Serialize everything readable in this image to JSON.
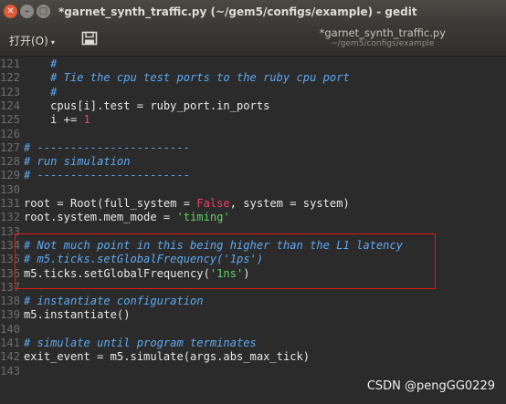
{
  "window": {
    "title": "*garnet_synth_traffic.py (~/gem5/configs/example) - gedit",
    "close_glyph": "✕",
    "minimize_glyph": "–",
    "maximize_glyph": "□"
  },
  "toolbar": {
    "open_label": "打开(O)",
    "open_arrow": "▾",
    "save_icon": "save-icon",
    "doc_title": "*garnet_synth_traffic.py",
    "doc_path": "~/gem5/configs/example"
  },
  "editor": {
    "lines": [
      {
        "n": "121",
        "segs": [
          {
            "t": "    #",
            "c": "comment"
          }
        ]
      },
      {
        "n": "122",
        "segs": [
          {
            "t": "    # Tie the cpu test ports to the ruby cpu port",
            "c": "comment"
          }
        ]
      },
      {
        "n": "123",
        "segs": [
          {
            "t": "    #",
            "c": "comment"
          }
        ]
      },
      {
        "n": "124",
        "segs": [
          {
            "t": "    cpus[i].test = ruby_port.in_ports",
            "c": "plain"
          }
        ]
      },
      {
        "n": "125",
        "segs": [
          {
            "t": "    i += ",
            "c": "plain"
          },
          {
            "t": "1",
            "c": "num"
          }
        ]
      },
      {
        "n": "126",
        "segs": []
      },
      {
        "n": "127",
        "segs": [
          {
            "t": "# -----------------------",
            "c": "comment"
          }
        ]
      },
      {
        "n": "128",
        "segs": [
          {
            "t": "# run simulation",
            "c": "comment"
          }
        ]
      },
      {
        "n": "129",
        "segs": [
          {
            "t": "# -----------------------",
            "c": "comment"
          }
        ]
      },
      {
        "n": "130",
        "segs": []
      },
      {
        "n": "131",
        "segs": [
          {
            "t": "root = Root(full_system = ",
            "c": "plain"
          },
          {
            "t": "False",
            "c": "false"
          },
          {
            "t": ", system = system)",
            "c": "plain"
          }
        ]
      },
      {
        "n": "132",
        "segs": [
          {
            "t": "root.system.mem_mode = ",
            "c": "plain"
          },
          {
            "t": "'timing'",
            "c": "str"
          }
        ]
      },
      {
        "n": "133",
        "segs": []
      },
      {
        "n": "134",
        "segs": [
          {
            "t": "# Not much point in this being higher than the L1 latency",
            "c": "comment"
          }
        ]
      },
      {
        "n": "135",
        "segs": [
          {
            "t": "# m5.ticks.setGlobalFrequency('1ps')",
            "c": "comment"
          }
        ]
      },
      {
        "n": "136",
        "segs": [
          {
            "t": "m5.ticks.setGlobalFrequency(",
            "c": "plain"
          },
          {
            "t": "'1ns'",
            "c": "str"
          },
          {
            "t": ")",
            "c": "plain"
          }
        ]
      },
      {
        "n": "137",
        "segs": []
      },
      {
        "n": "138",
        "segs": [
          {
            "t": "# instantiate configuration",
            "c": "comment"
          }
        ]
      },
      {
        "n": "139",
        "segs": [
          {
            "t": "m5.instantiate()",
            "c": "plain"
          }
        ]
      },
      {
        "n": "140",
        "segs": []
      },
      {
        "n": "141",
        "segs": [
          {
            "t": "# simulate until program terminates",
            "c": "comment"
          }
        ]
      },
      {
        "n": "142",
        "segs": [
          {
            "t": "exit_event = m5.simulate(args.abs_max_tick)",
            "c": "plain"
          }
        ]
      },
      {
        "n": "143",
        "segs": []
      }
    ]
  },
  "watermark": "CSDN @pengGG0229",
  "colors": {
    "comment": "#5fa8f0",
    "string": "#5ed16b",
    "keyword_false": "#f0406a",
    "highlight_box": "#e01818"
  }
}
